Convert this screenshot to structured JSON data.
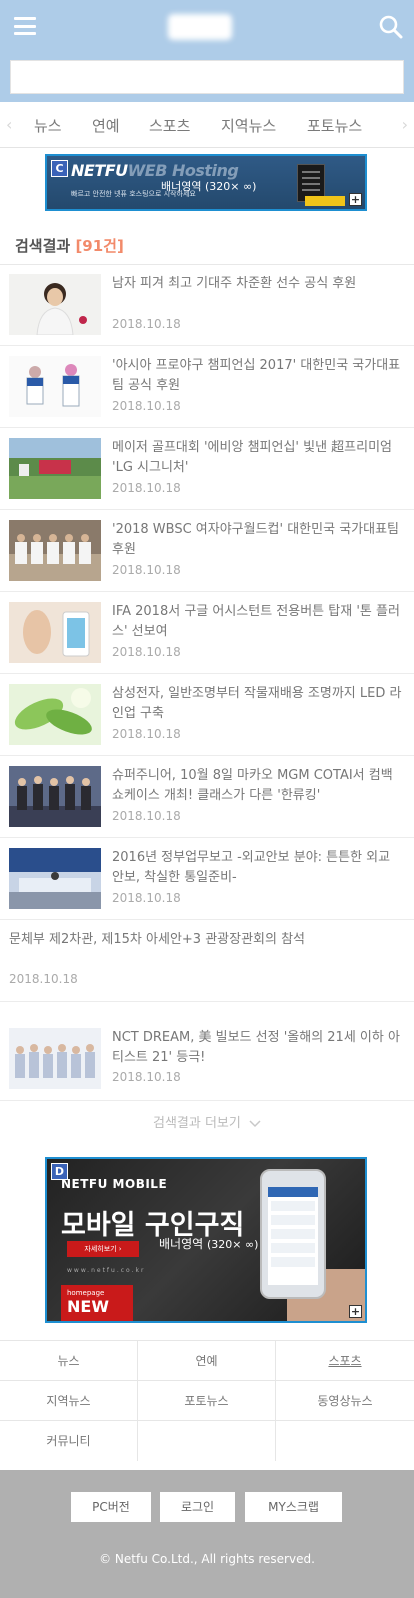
{
  "header": {
    "search_placeholder": ""
  },
  "categories": [
    "뉴스",
    "연예",
    "스포츠",
    "지역뉴스",
    "포토뉴스"
  ],
  "banner_c": {
    "tag": "C",
    "brand_main": "NETFU",
    "brand_sub": "WEB Hosting",
    "tagline": "빠르고 안전한 넷퓨 호스팅으로 시작하세요",
    "label": "배너영역",
    "size": "(320× ∞)"
  },
  "results": {
    "label": "검색결과",
    "count": "[91건]"
  },
  "news": [
    {
      "title": "남자 피겨 최고 기대주 차준환 선수 공식 후원",
      "date": "2018.10.18",
      "thumb": "skater"
    },
    {
      "title": "'아시아 프로야구 챔피언십 2017' 대한민국 국가대표팀 공식 후원",
      "date": "2018.10.18",
      "thumb": "baseball"
    },
    {
      "title": "메이저 골프대회 '에비앙 챔피언십' 빛낸 超프리미엄 'LG 시그니처'",
      "date": "2018.10.18",
      "thumb": "golf"
    },
    {
      "title": "'2018 WBSC 여자야구월드컵' 대한민국 국가대표팀 후원",
      "date": "2018.10.18",
      "thumb": "team"
    },
    {
      "title": "IFA 2018서 구글 어시스턴트 전용버튼 탑재 '톤 플러스' 선보여",
      "date": "2018.10.18",
      "thumb": "ifa"
    },
    {
      "title": "삼성전자, 일반조명부터 작물재배용 조명까지 LED 라인업 구축",
      "date": "2018.10.18",
      "thumb": "led"
    },
    {
      "title": "슈퍼주니어, 10월 8일 마카오 MGM COTAI서 컴백 쇼케이스 개최! 클래스가 다른 '한류킹'",
      "date": "2018.10.18",
      "thumb": "sj"
    },
    {
      "title": "2016년 정부업무보고 -외교안보 분야: 튼튼한 외교안보, 착실한 통일준비-",
      "date": "2018.10.18",
      "thumb": "gov"
    },
    {
      "title": "문체부 제2차관, 제15차 아세안+3 관광장관회의 참석",
      "date": "2018.10.18",
      "thumb": ""
    },
    {
      "title": "NCT DREAM, 美 빌보드 선정 '올해의 21세 이하 아티스트 21' 등극!",
      "date": "2018.10.18",
      "thumb": "nct"
    }
  ],
  "more_label": "검색결과 더보기",
  "banner_d": {
    "tag": "D",
    "line1": "NETFU MOBILE",
    "line2": "모바일 구인구직",
    "button": "자세히보기 ›",
    "url": "www.netfu.co.kr",
    "homepage": "homepage",
    "new": "NEW",
    "label": "배너영역",
    "size": "(320× ∞)"
  },
  "footer_nav": [
    "뉴스",
    "연예",
    "스포츠",
    "지역뉴스",
    "포토뉴스",
    "동영상뉴스",
    "커뮤니티"
  ],
  "footer": {
    "pc": "PC버전",
    "login": "로그인",
    "my": "MY스크랩",
    "copyright": "© Netfu Co.Ltd., All rights reserved."
  }
}
